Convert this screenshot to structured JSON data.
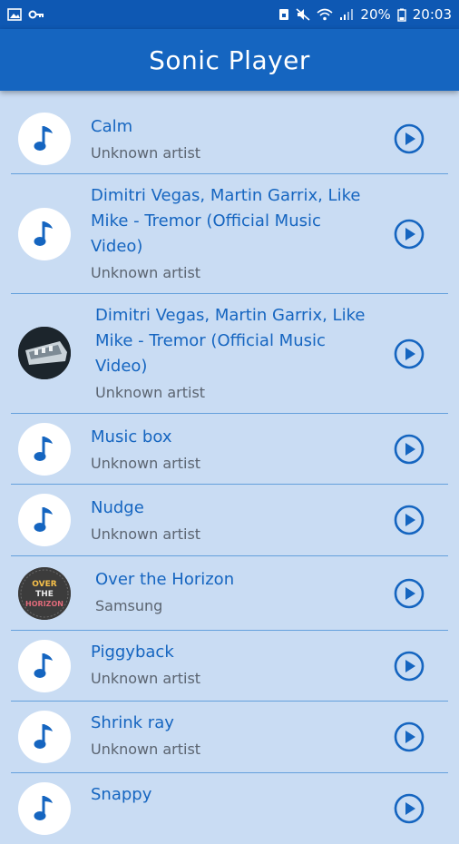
{
  "status": {
    "battery": "20%",
    "time": "20:03"
  },
  "app": {
    "title": "Sonic Player"
  },
  "songs": [
    {
      "title": "Calm",
      "artist": "Unknown artist",
      "art": "note"
    },
    {
      "title": "Dimitri Vegas, Martin Garrix, Like Mike - Tremor (Official Music Video)",
      "artist": "Unknown artist",
      "art": "note"
    },
    {
      "title": "Dimitri Vegas, Martin Garrix, Like Mike - Tremor (Official Music Video)",
      "artist": "Unknown artist",
      "art": "photo"
    },
    {
      "title": "Music box",
      "artist": "Unknown artist",
      "art": "note"
    },
    {
      "title": "Nudge",
      "artist": "Unknown artist",
      "art": "note"
    },
    {
      "title": "Over the Horizon",
      "artist": "Samsung",
      "art": "horizon",
      "art_text": [
        "OVER",
        "THE",
        "HORIZON"
      ]
    },
    {
      "title": "Piggyback",
      "artist": "Unknown artist",
      "art": "note"
    },
    {
      "title": "Shrink ray",
      "artist": "Unknown artist",
      "art": "note"
    },
    {
      "title": "Snappy",
      "artist": "",
      "art": "note"
    }
  ],
  "colors": {
    "accent": "#1565c0",
    "background": "#c9dcf3",
    "divider": "#64a0dc"
  }
}
